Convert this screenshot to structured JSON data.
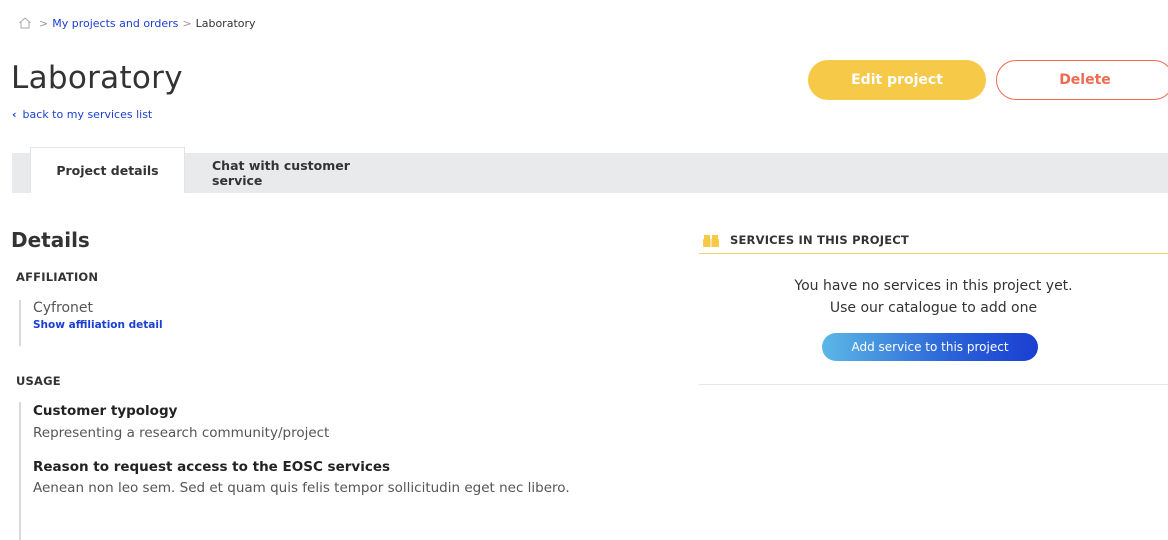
{
  "breadcrumb": {
    "home_icon": "home-icon",
    "separator": ">",
    "items": [
      "My projects and orders",
      "Laboratory"
    ]
  },
  "page": {
    "title": "Laboratory",
    "back_label": "back to my services list"
  },
  "actions": {
    "edit_label": "Edit project",
    "delete_label": "Delete"
  },
  "tabs": [
    {
      "label": "Project details",
      "active": true
    },
    {
      "label": "Chat with customer service",
      "active": false
    }
  ],
  "details": {
    "title": "Details",
    "affiliation": {
      "label": "AFFILIATION",
      "name": "Cyfronet",
      "link": "Show affiliation detail"
    },
    "usage": {
      "label": "USAGE",
      "items": [
        {
          "heading": "Customer typology",
          "text": "Representing a research community/project"
        },
        {
          "heading": "Reason to request access to the EOSC services",
          "text": "Aenean non leo sem. Sed et quam quis felis tempor sollicitudin eget nec libero."
        }
      ]
    }
  },
  "services": {
    "icon": "boxes-icon",
    "title": "SERVICES IN THIS PROJECT",
    "empty_line1": "You have no services in this project yet.",
    "empty_line2": "Use our catalogue to add one",
    "add_label": "Add service to this project"
  },
  "colors": {
    "accent_yellow": "#f7c948",
    "delete_red": "#ef6a4f",
    "link_blue": "#1a3fd1",
    "tab_bg": "#e9eaeb"
  }
}
